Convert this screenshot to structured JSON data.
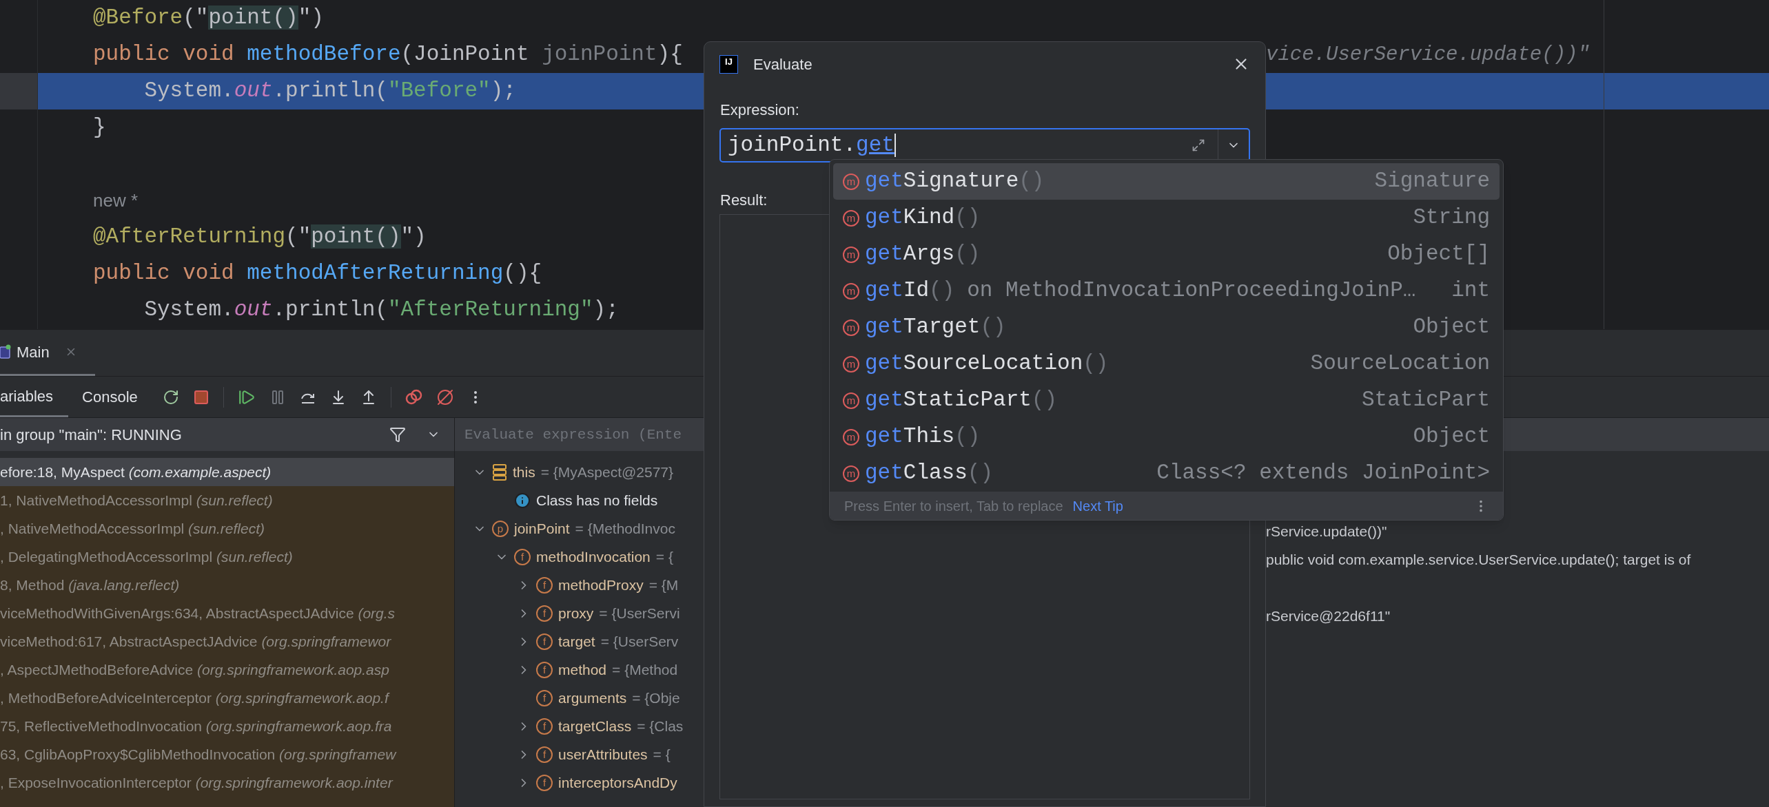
{
  "editor": {
    "lines": [
      {
        "kind": "code",
        "current": false,
        "tokens": [
          {
            "text": "@Before",
            "kind": "annotation"
          },
          {
            "text": "(\"",
            "kind": "plain"
          },
          {
            "text": "point()",
            "kind": "ref"
          },
          {
            "text": "\")",
            "kind": "plain"
          }
        ]
      },
      {
        "kind": "code",
        "current": false,
        "tokens": [
          {
            "text": "public void ",
            "kind": "keyword"
          },
          {
            "text": "methodBefore",
            "kind": "method"
          },
          {
            "text": "(JoinPoint ",
            "kind": "plain"
          },
          {
            "text": "joinPoint",
            "kind": "param"
          },
          {
            "text": "){",
            "kind": "plain"
          }
        ],
        "trailing": "vice.UserService.update())\""
      },
      {
        "kind": "code",
        "current": true,
        "tokens": [
          {
            "text": "    System.",
            "kind": "plain"
          },
          {
            "text": "out",
            "kind": "field"
          },
          {
            "text": ".println(",
            "kind": "plain"
          },
          {
            "text": "\"Before\"",
            "kind": "string"
          },
          {
            "text": ");",
            "kind": "plain"
          }
        ]
      },
      {
        "kind": "code",
        "current": false,
        "tokens": [
          {
            "text": "}",
            "kind": "plain"
          }
        ]
      },
      {
        "kind": "blank",
        "current": false
      },
      {
        "kind": "hint",
        "current": false,
        "text": "new *"
      },
      {
        "kind": "code",
        "current": false,
        "tokens": [
          {
            "text": "@AfterReturning",
            "kind": "annotation"
          },
          {
            "text": "(\"",
            "kind": "plain"
          },
          {
            "text": "point()",
            "kind": "ref"
          },
          {
            "text": "\")",
            "kind": "plain"
          }
        ]
      },
      {
        "kind": "code",
        "current": false,
        "tokens": [
          {
            "text": "public void ",
            "kind": "keyword"
          },
          {
            "text": "methodAfterReturning",
            "kind": "method"
          },
          {
            "text": "(){",
            "kind": "plain"
          }
        ]
      },
      {
        "kind": "code",
        "current": false,
        "tokens": [
          {
            "text": "    System.",
            "kind": "plain"
          },
          {
            "text": "out",
            "kind": "field"
          },
          {
            "text": ".println(",
            "kind": "plain"
          },
          {
            "text": "\"AfterReturning\"",
            "kind": "string"
          },
          {
            "text": ");",
            "kind": "plain"
          }
        ]
      }
    ]
  },
  "debug": {
    "tabs": [
      {
        "label": "Main",
        "selected": true
      }
    ],
    "subtabs": [
      {
        "label": "ariables",
        "selected": true
      },
      {
        "label": "Console",
        "selected": false
      }
    ],
    "thread": "in group \"main\": RUNNING",
    "frames": [
      {
        "text": "efore:18, MyAspect *(com.example.aspect)*",
        "selected": true,
        "library": false
      },
      {
        "text": "1, NativeMethodAccessorImpl *(sun.reflect)*",
        "selected": false,
        "library": true
      },
      {
        "text": ", NativeMethodAccessorImpl *(sun.reflect)*",
        "selected": false,
        "library": true
      },
      {
        "text": ", DelegatingMethodAccessorImpl *(sun.reflect)*",
        "selected": false,
        "library": true
      },
      {
        "text": "8, Method *(java.lang.reflect)*",
        "selected": false,
        "library": true
      },
      {
        "text": "viceMethodWithGivenArgs:634, AbstractAspectJAdvice *(org.s*",
        "selected": false,
        "library": true
      },
      {
        "text": "viceMethod:617, AbstractAspectJAdvice *(org.springframewor*",
        "selected": false,
        "library": true
      },
      {
        "text": ", AspectJMethodBeforeAdvice *(org.springframework.aop.asp*",
        "selected": false,
        "library": true
      },
      {
        "text": ", MethodBeforeAdviceInterceptor *(org.springframework.aop.f*",
        "selected": false,
        "library": true
      },
      {
        "text": "75, ReflectiveMethodInvocation *(org.springframework.aop.fra*",
        "selected": false,
        "library": true
      },
      {
        "text": "63, CglibAopProxy$CglibMethodInvocation *(org.springframew*",
        "selected": false,
        "library": true
      },
      {
        "text": ", ExposeInvocationInterceptor *(org.springframework.aop.inter*",
        "selected": false,
        "library": true
      }
    ],
    "evaluate_field": {
      "placeholder": "Evaluate expression (Ente"
    },
    "variables": [
      {
        "kind": "object",
        "name": "this",
        "value": "= {MyAspect@2577}",
        "expanded": true,
        "children": [
          {
            "kind": "info",
            "name": "Class has no fields"
          }
        ]
      },
      {
        "kind": "param",
        "badge": "p",
        "name": "joinPoint",
        "value": "= {MethodInvoc",
        "tail": "rService.update())\"",
        "expanded": true,
        "children": [
          {
            "kind": "field",
            "badge": "f",
            "name": "methodInvocation",
            "value": "= {",
            "tail": "public void com.example.service.UserService.update(); target is of",
            "expanded": true,
            "children": [
              {
                "kind": "field",
                "badge": "f",
                "name": "methodProxy",
                "value": "= {M",
                "expanded": false
              },
              {
                "kind": "field",
                "badge": "f",
                "name": "proxy",
                "value": "= {UserServi",
                "tail": "rService@22d6f11\"",
                "expanded": false
              },
              {
                "kind": "field",
                "badge": "f",
                "name": "target",
                "value": "= {UserServ",
                "expanded": false
              },
              {
                "kind": "field",
                "badge": "f",
                "name": "method",
                "value": "= {Method",
                "expanded": false
              },
              {
                "kind": "field",
                "badge": "f",
                "name": "arguments",
                "value": "= {Obje"
              },
              {
                "kind": "field",
                "badge": "f",
                "name": "targetClass",
                "value": "= {Clas",
                "expanded": false
              },
              {
                "kind": "field",
                "badge": "f",
                "name": "userAttributes",
                "value": "= {",
                "expanded": false
              },
              {
                "kind": "field",
                "badge": "f",
                "name": "interceptorsAndDy",
                "expanded": false
              }
            ]
          }
        ]
      }
    ]
  },
  "dialog": {
    "logo": "IJ",
    "title": "Evaluate",
    "expression_label": "Expression:",
    "expression": {
      "typed": "joinPoint.",
      "completing": "get"
    },
    "result_label": "Result:"
  },
  "completion": {
    "items": [
      {
        "badge": "m",
        "match": "get",
        "rest": "Signature",
        "params": "()",
        "type": "Signature",
        "selected": true
      },
      {
        "badge": "m",
        "match": "get",
        "rest": "Kind",
        "params": "()",
        "type": "String",
        "selected": false
      },
      {
        "badge": "m",
        "match": "get",
        "rest": "Args",
        "params": "()",
        "type": "Object[]",
        "selected": false
      },
      {
        "badge": "m",
        "match": "get",
        "rest": "Id",
        "params": "()",
        "location": "on MethodInvocationProceedingJoinP…",
        "type": "int",
        "selected": false
      },
      {
        "badge": "m",
        "match": "get",
        "rest": "Target",
        "params": "()",
        "type": "Object",
        "selected": false
      },
      {
        "badge": "m",
        "match": "get",
        "rest": "SourceLocation",
        "params": "()",
        "type": "SourceLocation",
        "selected": false
      },
      {
        "badge": "m",
        "match": "get",
        "rest": "StaticPart",
        "params": "()",
        "type": "StaticPart",
        "selected": false
      },
      {
        "badge": "m",
        "match": "get",
        "rest": "This",
        "params": "()",
        "type": "Object",
        "selected": false
      },
      {
        "badge": "m",
        "match": "get",
        "rest": "Class",
        "params": "()",
        "type": "Class<? extends JoinPoint>",
        "selected": false
      }
    ],
    "footer": {
      "hint": "Press Enter to insert, Tab to replace",
      "link": "Next Tip"
    }
  }
}
